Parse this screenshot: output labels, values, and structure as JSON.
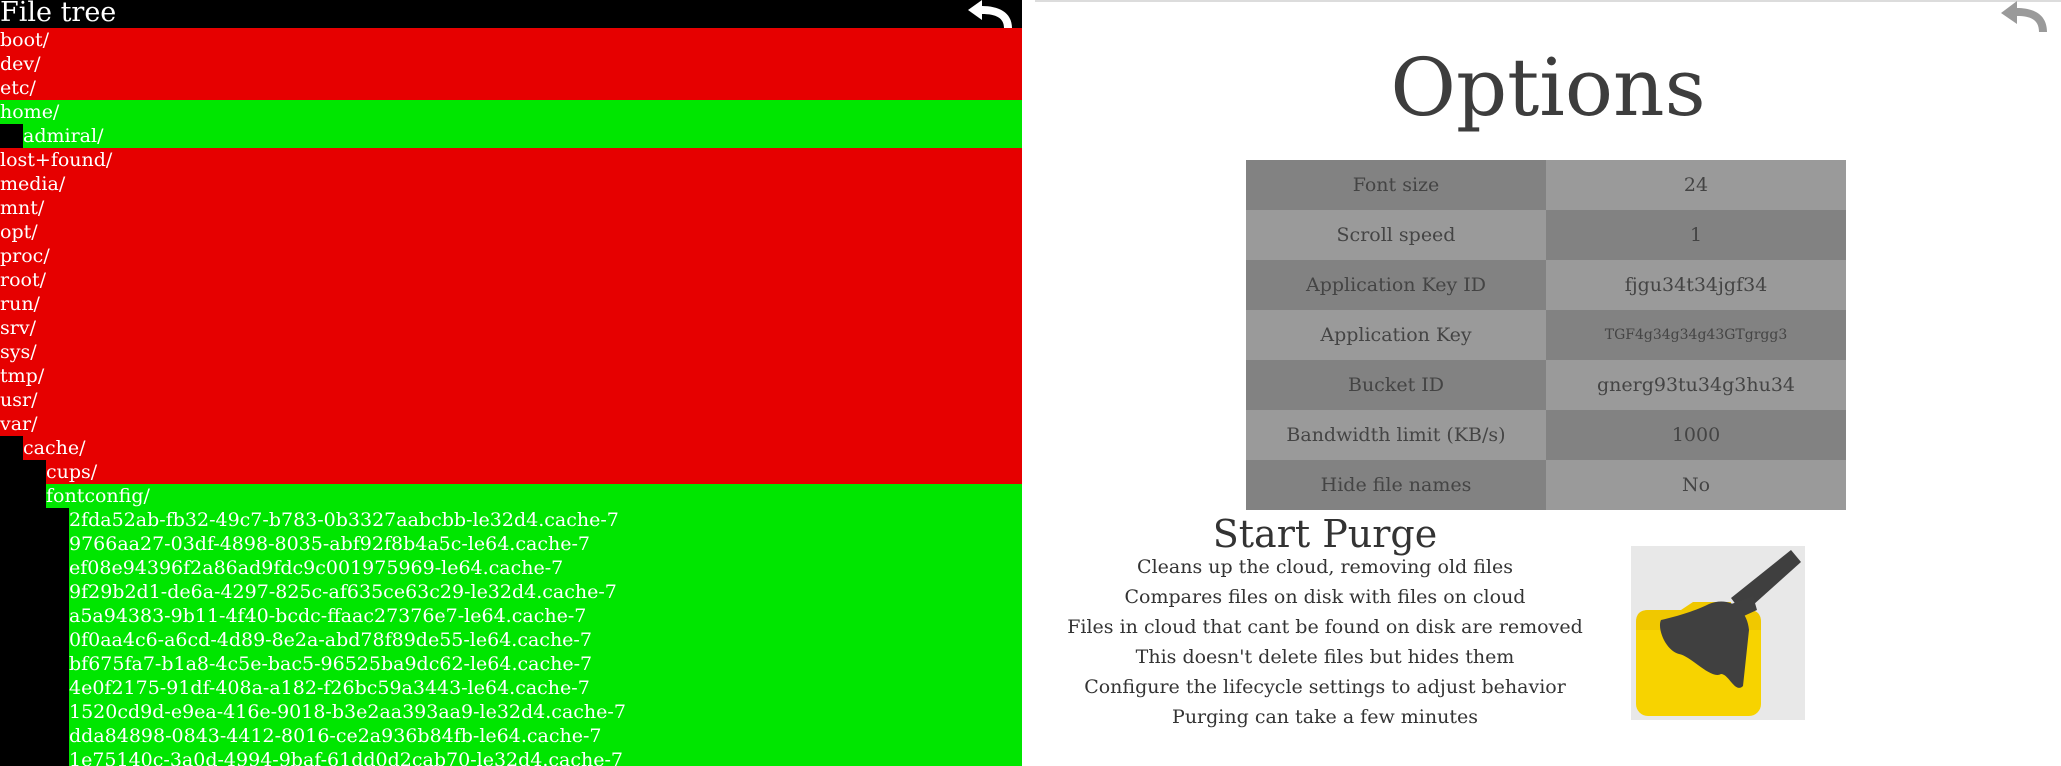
{
  "file_tree": {
    "title": "File tree",
    "back_icon": "back-arrow-icon",
    "rows": [
      {
        "label": "boot/",
        "depth": 0,
        "status": "red"
      },
      {
        "label": "dev/",
        "depth": 0,
        "status": "red"
      },
      {
        "label": "etc/",
        "depth": 0,
        "status": "red"
      },
      {
        "label": "home/",
        "depth": 0,
        "status": "green"
      },
      {
        "label": "admiral/",
        "depth": 1,
        "status": "green"
      },
      {
        "label": "lost+found/",
        "depth": 0,
        "status": "red"
      },
      {
        "label": "media/",
        "depth": 0,
        "status": "red"
      },
      {
        "label": "mnt/",
        "depth": 0,
        "status": "red"
      },
      {
        "label": "opt/",
        "depth": 0,
        "status": "red"
      },
      {
        "label": "proc/",
        "depth": 0,
        "status": "red"
      },
      {
        "label": "root/",
        "depth": 0,
        "status": "red"
      },
      {
        "label": "run/",
        "depth": 0,
        "status": "red"
      },
      {
        "label": "srv/",
        "depth": 0,
        "status": "red"
      },
      {
        "label": "sys/",
        "depth": 0,
        "status": "red"
      },
      {
        "label": "tmp/",
        "depth": 0,
        "status": "red"
      },
      {
        "label": "usr/",
        "depth": 0,
        "status": "red"
      },
      {
        "label": "var/",
        "depth": 0,
        "status": "red"
      },
      {
        "label": "cache/",
        "depth": 1,
        "status": "red"
      },
      {
        "label": "cups/",
        "depth": 2,
        "status": "red"
      },
      {
        "label": "fontconfig/",
        "depth": 2,
        "status": "green"
      },
      {
        "label": "2fda52ab-fb32-49c7-b783-0b3327aabcbb-le32d4.cache-7",
        "depth": 3,
        "status": "green"
      },
      {
        "label": "9766aa27-03df-4898-8035-abf92f8b4a5c-le64.cache-7",
        "depth": 3,
        "status": "green"
      },
      {
        "label": "ef08e94396f2a86ad9fdc9c001975969-le64.cache-7",
        "depth": 3,
        "status": "green"
      },
      {
        "label": "9f29b2d1-de6a-4297-825c-af635ce63c29-le32d4.cache-7",
        "depth": 3,
        "status": "green"
      },
      {
        "label": "a5a94383-9b11-4f40-bcdc-ffaac27376e7-le64.cache-7",
        "depth": 3,
        "status": "green"
      },
      {
        "label": "0f0aa4c6-a6cd-4d89-8e2a-abd78f89de55-le64.cache-7",
        "depth": 3,
        "status": "green"
      },
      {
        "label": "bf675fa7-b1a8-4c5e-bac5-96525ba9dc62-le64.cache-7",
        "depth": 3,
        "status": "green"
      },
      {
        "label": "4e0f2175-91df-408a-a182-f26bc59a3443-le64.cache-7",
        "depth": 3,
        "status": "green"
      },
      {
        "label": "1520cd9d-e9ea-416e-9018-b3e2aa393aa9-le32d4.cache-7",
        "depth": 3,
        "status": "green"
      },
      {
        "label": "dda84898-0843-4412-8016-ce2a936b84fb-le64.cache-7",
        "depth": 3,
        "status": "green"
      },
      {
        "label": "1e75140c-3a0d-4994-9baf-61dd0d2cab70-le32d4.cache-7",
        "depth": 3,
        "status": "green"
      }
    ]
  },
  "options": {
    "title": "Options",
    "back_icon": "back-arrow-icon",
    "rows": [
      {
        "key": "Font size",
        "value": "24"
      },
      {
        "key": "Scroll speed",
        "value": "1"
      },
      {
        "key": "Application Key ID",
        "value": "fjgu34t34jgf34"
      },
      {
        "key": "Application Key",
        "value": "TGF4g34g34g43GTgrgg3"
      },
      {
        "key": "Bucket ID",
        "value": "gnerg93tu34g3hu34"
      },
      {
        "key": "Bandwidth limit (KB/s)",
        "value": "1000"
      },
      {
        "key": "Hide file names",
        "value": "No"
      }
    ]
  },
  "purge": {
    "title": "Start Purge",
    "lines": [
      "Cleans up the cloud, removing old files",
      "Compares files on disk with files on cloud",
      "Files in cloud that cant be found on disk are removed",
      "This doesn't delete files but hides them",
      "Configure the lifecycle settings to adjust behavior",
      "Purging can take a few minutes"
    ],
    "icon": "broom-icon"
  },
  "colors": {
    "missing": "#e60000",
    "present": "#00e600",
    "table_dark": "#828282",
    "table_light": "#9a9a9a"
  }
}
